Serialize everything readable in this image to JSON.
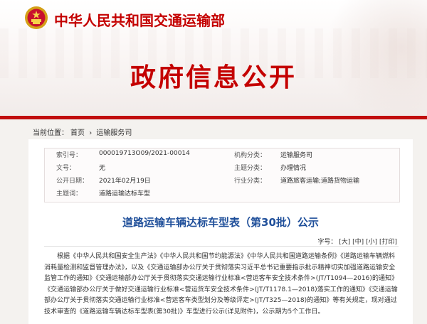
{
  "header": {
    "ministry_name": "中华人民共和国交通运输部",
    "page_title": "政府信息公开"
  },
  "breadcrumb": {
    "label": "当前位置：",
    "home": "首页",
    "sep": "›",
    "section": "运输服务司"
  },
  "info": {
    "index_label": "索引号：",
    "index_value": "000019713O09/2021-00014",
    "agency_label": "机构分类：",
    "agency_value": "运输服务司",
    "docno_label": "文号：",
    "docno_value": "无",
    "topic_label": "主题分类：",
    "topic_value": "办理情况",
    "date_label": "公开日期：",
    "date_value": "2021年02月19日",
    "industry_label": "行业分类：",
    "industry_value": "道路旅客运输;道路货物运输",
    "keyword_label": "主题词：",
    "keyword_value": "道路运输达标车型"
  },
  "article": {
    "title": "道路运输车辆达标车型表（第30批）公示",
    "fontsize_label": "字号：",
    "font_large": "[大]",
    "font_medium": "[中]",
    "font_small": "[小]",
    "print": "[打印]",
    "body": "根据《中华人民共和国安全生产法》《中华人民共和国节约能源法》《中华人民共和国道路运输条例》《道路运输车辆燃料消耗量检测和监督管理办法》，以及《交通运输部办公厅关于贯彻落实习近平总书记重要指示批示精神切实加强道路运输安全监管工作的通知》《交通运输部办公厅关于贯彻落实交通运输行业标准<营运客车安全技术条件>(JT/T1094—2016)的通知》《交通运输部办公厅关于做好交通运输行业标准<营运货车安全技术条件>(JT/T1178.1—2018)落实工作的通知》《交通运输部办公厅关于贯彻落实交通运输行业标准<营运客车类型划分及等级评定>(JT/T325—2018)的通知》等有关规定，现对通过技术审查的《道路运输车辆达标车型表(第30批)》车型进行公示(详见附件)，公示期为5个工作日。"
  },
  "colors": {
    "brand_red": "#c40000",
    "title_blue": "#1f4f9a"
  }
}
